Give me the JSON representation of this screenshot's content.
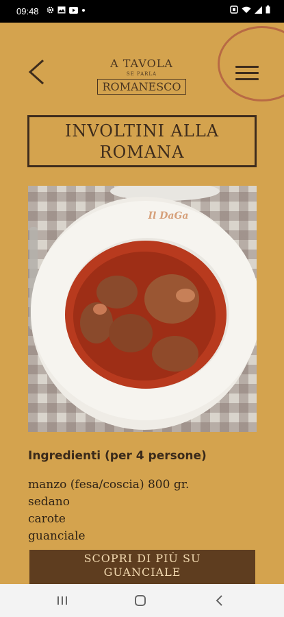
{
  "status_bar": {
    "time": "09:48",
    "left_icons": [
      "gear-icon",
      "image-icon",
      "youtube-icon",
      "dot-icon"
    ],
    "right_icons": [
      "alarm-icon",
      "wifi-icon",
      "signal-icon",
      "battery-icon"
    ]
  },
  "header": {
    "logo_line1": "A TAVOLA",
    "logo_line2": "SE PARLA",
    "logo_line3": "ROMANESCO"
  },
  "recipe": {
    "title_line1": "INVOLTINI ALLA",
    "title_line2": "ROMANA",
    "photo_plate_text": "Il DaGa"
  },
  "ingredients": {
    "title": "Ingredienti (per 4 persone)",
    "items": [
      "manzo (fesa/coscia) 800 gr.",
      "sedano",
      "carote",
      "guanciale"
    ]
  },
  "cta": {
    "line1": "SCOPRI DI PIÙ SU",
    "line2": "GUANCIALE"
  },
  "colors": {
    "background": "#d4a34e",
    "text": "#3e2c1c",
    "button": "#5e3d1f"
  }
}
